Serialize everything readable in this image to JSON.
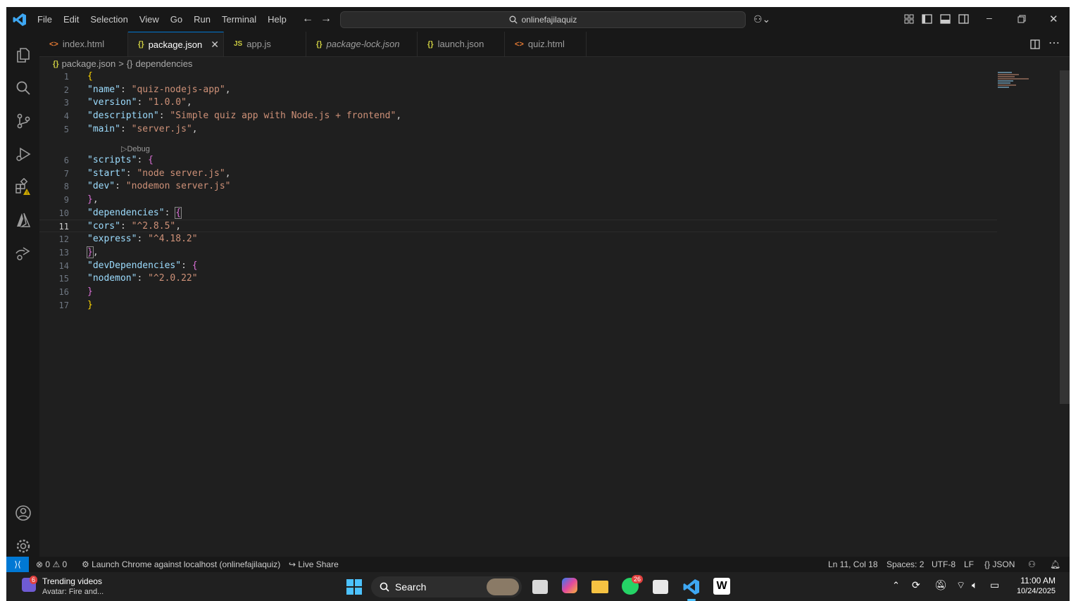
{
  "menu": [
    "File",
    "Edit",
    "Selection",
    "View",
    "Go",
    "Run",
    "Terminal",
    "Help"
  ],
  "search": {
    "text": "onlinefajilaquiz"
  },
  "tabs": [
    {
      "label": "index.html",
      "icon": "html"
    },
    {
      "label": "package.json",
      "icon": "json",
      "active": true
    },
    {
      "label": "app.js",
      "icon": "js"
    },
    {
      "label": "package-lock.json",
      "icon": "json",
      "italic": true
    },
    {
      "label": "launch.json",
      "icon": "json"
    },
    {
      "label": "quiz.html",
      "icon": "html"
    }
  ],
  "icons": {
    "html": "<>",
    "json": "{}",
    "js": "JS"
  },
  "breadcrumb": {
    "file": "package.json",
    "sep": ">",
    "node": "dependencies"
  },
  "code_lens": "Debug",
  "lines": [
    {
      "n": "1"
    },
    {
      "n": "2"
    },
    {
      "n": "3"
    },
    {
      "n": "4"
    },
    {
      "n": "5"
    },
    {
      "n": "6"
    },
    {
      "n": "7"
    },
    {
      "n": "8"
    },
    {
      "n": "9"
    },
    {
      "n": "10"
    },
    {
      "n": "11"
    },
    {
      "n": "12"
    },
    {
      "n": "13"
    },
    {
      "n": "14"
    },
    {
      "n": "15"
    },
    {
      "n": "16"
    },
    {
      "n": "17"
    }
  ],
  "code": {
    "name_key": "\"name\"",
    "name_val": "\"quiz-nodejs-app\"",
    "version_key": "\"version\"",
    "version_val": "\"1.0.0\"",
    "desc_key": "\"description\"",
    "desc_val": "\"Simple quiz app with Node.js + frontend\"",
    "main_key": "\"main\"",
    "main_val": "\"server.js\"",
    "scripts_key": "\"scripts\"",
    "start_key": "\"start\"",
    "start_val": "\"node server.js\"",
    "dev_key": "\"dev\"",
    "dev_val": "\"nodemon server.js\"",
    "deps_key": "\"dependencies\"",
    "cors_key": "\"cors\"",
    "cors_val": "\"^2.8.5\"",
    "express_key": "\"express\"",
    "express_val": "\"^4.18.2\"",
    "devdeps_key": "\"devDependencies\"",
    "nodemon_key": "\"nodemon\"",
    "nodemon_val": "\"^2.0.22\""
  },
  "status": {
    "errors": "0",
    "warnings": "0",
    "launch": "Launch Chrome against localhost (onlinefajilaquiz)",
    "liveshare": "Live Share",
    "position": "Ln 11, Col 18",
    "spaces": "Spaces: 2",
    "encoding": "UTF-8",
    "eol": "LF",
    "language": "{} JSON"
  },
  "taskbar": {
    "news_title": "Trending videos",
    "news_sub": "Avatar: Fire and...",
    "news_badge": "6",
    "search": "Search",
    "whatsapp_badge": "26",
    "time": "11:00 AM",
    "date": "10/24/2025"
  },
  "colors": {
    "accent": "#0078d4",
    "editor_bg": "#1f1f1f",
    "string": "#ce9178",
    "key": "#9cdcfe"
  }
}
